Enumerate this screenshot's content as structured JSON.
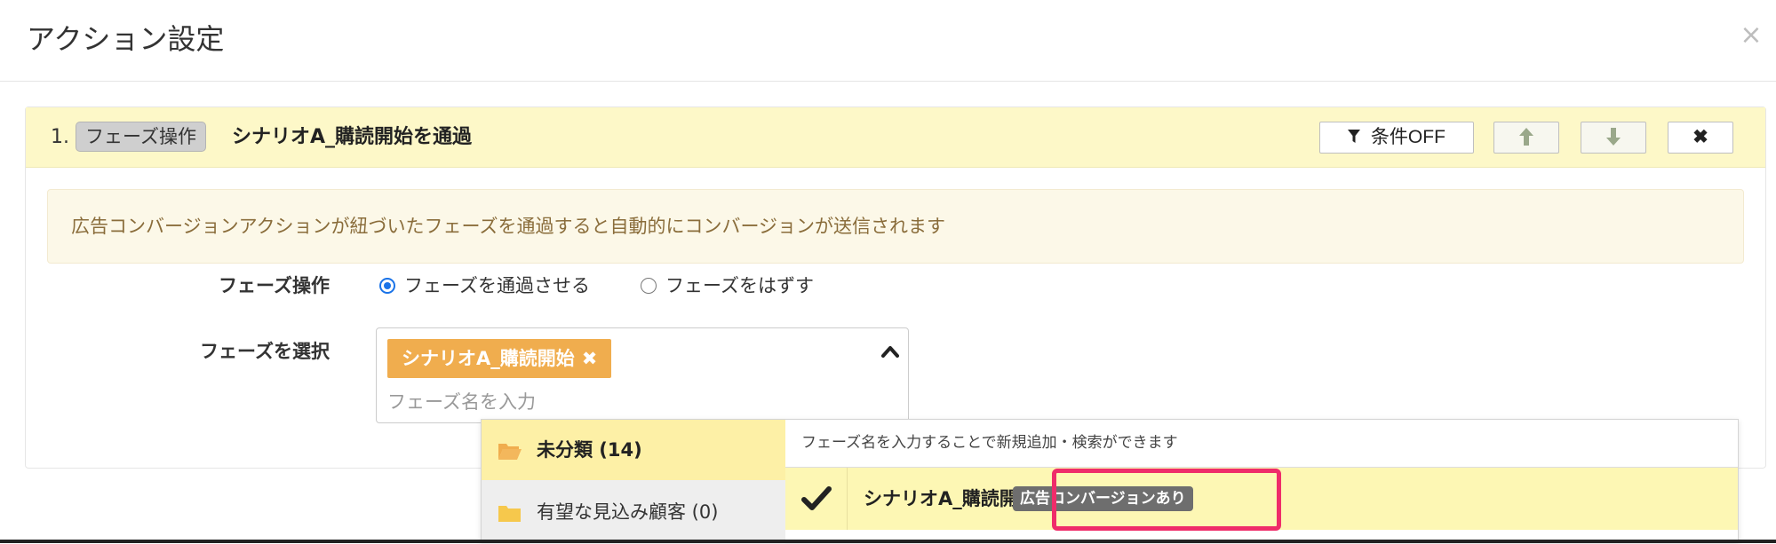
{
  "modal": {
    "title": "アクション設定",
    "close_label": "×"
  },
  "action": {
    "index": "1.",
    "type_tag": "フェーズ操作",
    "title": "シナリオA_購読開始を通過",
    "buttons": {
      "condition_label": "条件OFF",
      "move_up_label": "↑",
      "move_down_label": "↓",
      "delete_label": "✖"
    }
  },
  "notice": {
    "text": "広告コンバージョンアクションが紐づいたフェーズを通過すると自動的にコンバージョンが送信されます"
  },
  "form": {
    "phase_operation": {
      "label": "フェーズ操作",
      "options": [
        {
          "label": "フェーズを通過させる",
          "checked": true
        },
        {
          "label": "フェーズをはずす",
          "checked": false
        }
      ]
    },
    "phase_select": {
      "label": "フェーズを選択",
      "selected_chip": "シナリオA_購読開始",
      "chip_remove": "✖",
      "placeholder": "フェーズ名を入力"
    }
  },
  "dropdown": {
    "folders": [
      {
        "label": "未分類 (14)",
        "active": true
      },
      {
        "label": "有望な見込み顧客 (0)",
        "active": false
      }
    ],
    "hint": "フェーズ名を入力することで新規追加・検索ができます",
    "options": [
      {
        "label": "シナリオA_購読開始",
        "badge": "広告コンバージョンあり",
        "selected": true
      }
    ]
  },
  "colors": {
    "header_bg": "#fdf8c8",
    "notice_bg": "#fcf8e8",
    "notice_text": "#8a6d3b",
    "chip_bg": "#f0ad4e",
    "radio_accent": "#1a73e8",
    "folder_active_bg": "#fdf0a6",
    "option_selected_bg": "#fdf7b4",
    "badge_bg": "#6e6e6e",
    "highlight_border": "#ef2c6a"
  },
  "icons": {
    "filter": "filter-icon",
    "arrow_up": "arrow-up-icon",
    "arrow_down": "arrow-down-icon",
    "delete": "delete-icon",
    "caret": "chevron-up-icon",
    "folder_open": "folder-open-icon",
    "folder": "folder-icon",
    "check": "check-icon"
  }
}
